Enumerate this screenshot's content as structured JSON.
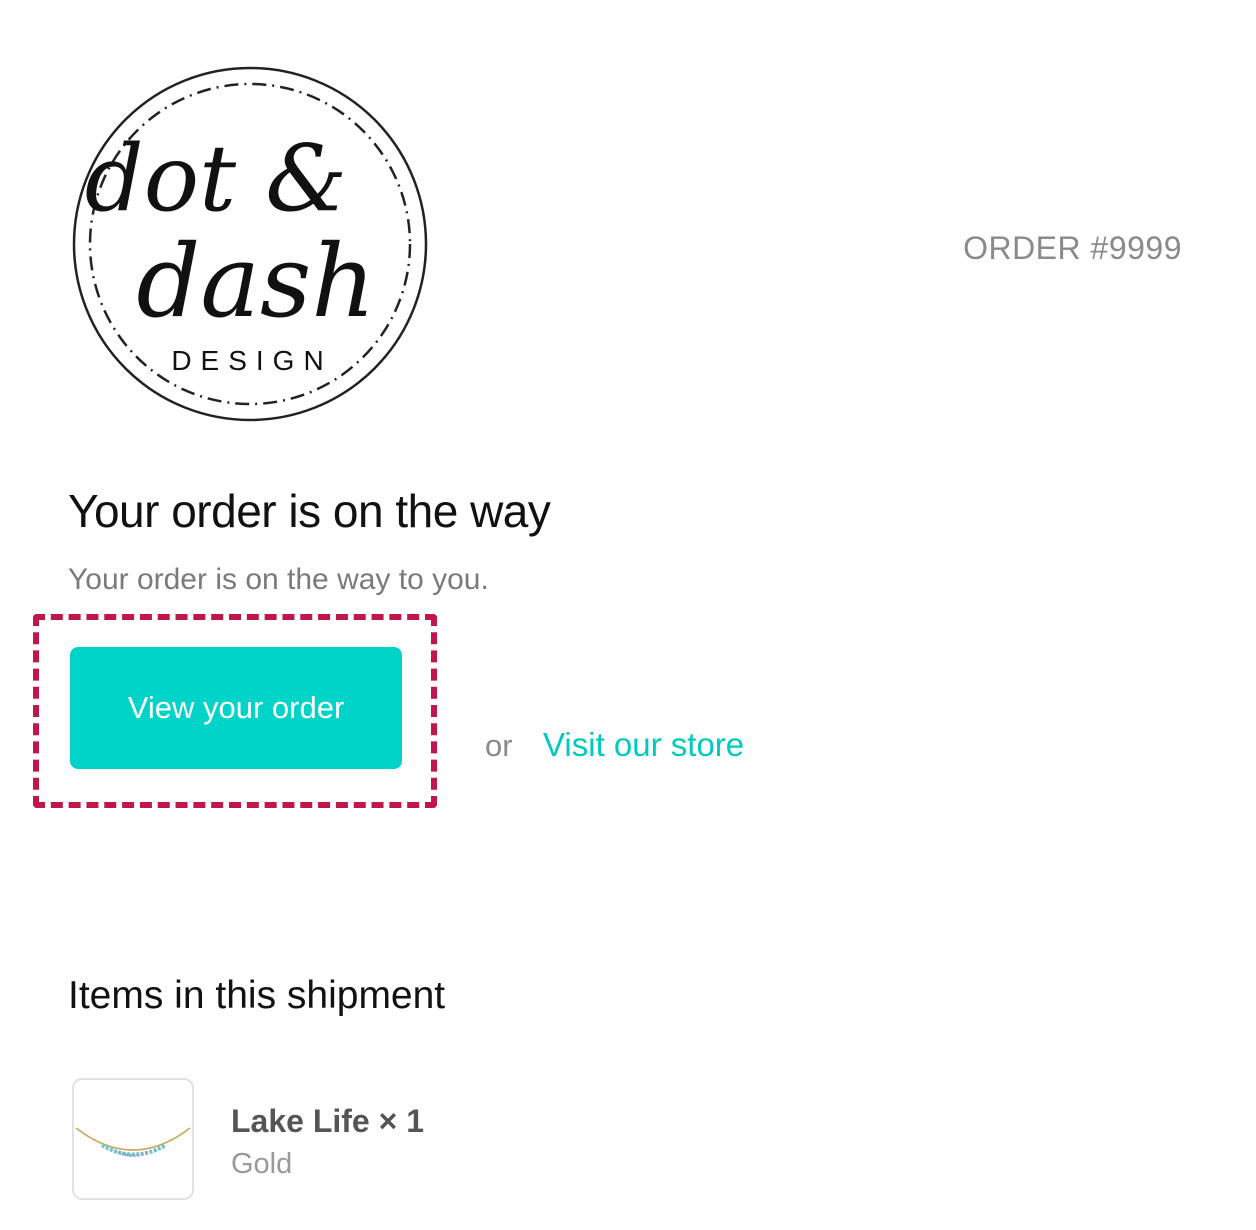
{
  "brand": {
    "logo_line1": "dot &",
    "logo_line2": "dash",
    "logo_line3": "DESIGN"
  },
  "order": {
    "number_label": "ORDER #9999"
  },
  "hero": {
    "heading": "Your order is on the way",
    "subtext": "Your order is on the way to you."
  },
  "actions": {
    "primary_label": "View your order",
    "separator": "or",
    "store_link_label": "Visit our store"
  },
  "shipment": {
    "title": "Items in this shipment",
    "items": [
      {
        "name": "Lake Life × 1",
        "variant": "Gold",
        "image_icon": "necklace-thumbnail"
      }
    ]
  },
  "colors": {
    "accent": "#00d4c8",
    "link": "#00c9be",
    "highlight": "#c0174a"
  }
}
